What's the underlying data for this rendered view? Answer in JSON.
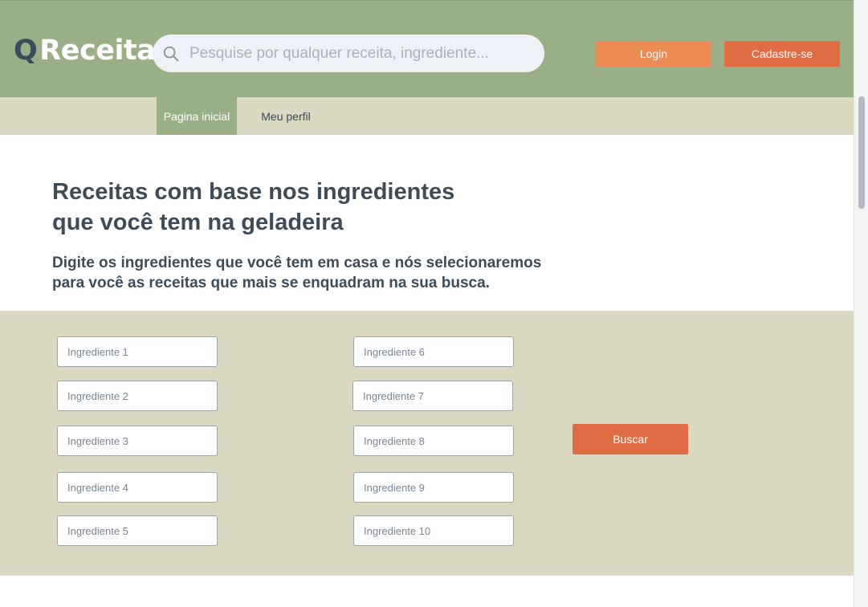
{
  "brand": {
    "logo_letter": "Q",
    "name": "Receita"
  },
  "search": {
    "placeholder": "Pesquise por qualquer receita, ingrediente...",
    "icon": "search-icon"
  },
  "header": {
    "login_label": "Login",
    "signup_label": "Cadastre-se"
  },
  "nav": {
    "tabs": [
      {
        "label": "Pagina inicial",
        "active": true
      },
      {
        "label": "Meu perfil",
        "active": false
      }
    ]
  },
  "hero": {
    "title_line1": "Receitas com base nos ingredientes",
    "title_line2": "que você tem na geladeira",
    "subtitle_line1": "Digite os ingredientes que você tem em casa e nós selecionaremos",
    "subtitle_line2": "para você as receitas que mais se enquadram na sua busca."
  },
  "ingredients": {
    "placeholders": [
      "Ingrediente 1",
      "Ingrediente 2",
      "Ingrediente 3",
      "Ingrediente 4",
      "Ingrediente 5",
      "Ingrediente 6",
      "Ingrediente 7",
      "Ingrediente 8",
      "Ingrediente 9",
      "Ingrediente 10"
    ],
    "values": [
      "",
      "",
      "",
      "",
      "",
      "",
      "",
      "",
      "",
      ""
    ],
    "submit_label": "Buscar"
  },
  "colors": {
    "header_bg": "#9aae88",
    "nav_bg": "#dad8c1",
    "accent": "#df6c42",
    "accent_light": "#ea8b54",
    "text": "#404b58"
  }
}
